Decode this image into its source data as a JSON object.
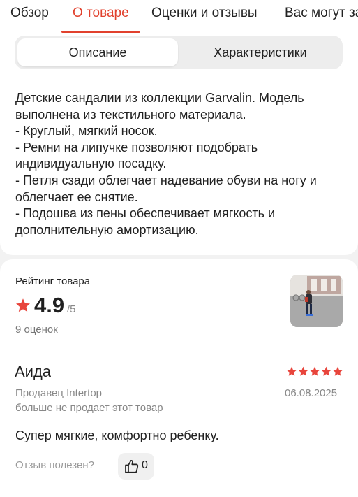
{
  "top_tabs": [
    {
      "label": "Обзор"
    },
    {
      "label": "О товаре"
    },
    {
      "label": "Оценки и отзывы"
    },
    {
      "label": "Вас могут за"
    }
  ],
  "active_tab": "О товаре",
  "segments": {
    "description": "Описание",
    "characteristics": "Характеристики"
  },
  "description_lines": [
    "Детские сандалии из коллекции Garvalin. Модель",
    "выполнена из текстильного материала.",
    "- Круглый, мягкий носок.",
    "- Ремни на липучке позволяют подобрать",
    "индивидуальную посадку.",
    "- Петля сзади облегчает надевание обуви на ногу и",
    "облегчает ее снятие.",
    "- Подошва из пены обеспечивает мягкость и",
    "дополнительную амортизацию."
  ],
  "rating": {
    "label": "Рейтинг товара",
    "value": "4.9",
    "max": "/5",
    "count": "9 оценок"
  },
  "review": {
    "author": "Аида",
    "stars": 5,
    "seller": "Продавец Intertop",
    "date": "06.08.2025",
    "seller_note": "больше не продает этот товар",
    "text": "Супер мягкие, комфортно ребенку.",
    "helpful_label": "Отзыв полезен?",
    "likes": "0"
  },
  "colors": {
    "accent": "#e1412d",
    "star": "#e8453c",
    "muted_text": "#888888"
  },
  "icons": [
    "star-icon",
    "thumbs-up-icon"
  ]
}
